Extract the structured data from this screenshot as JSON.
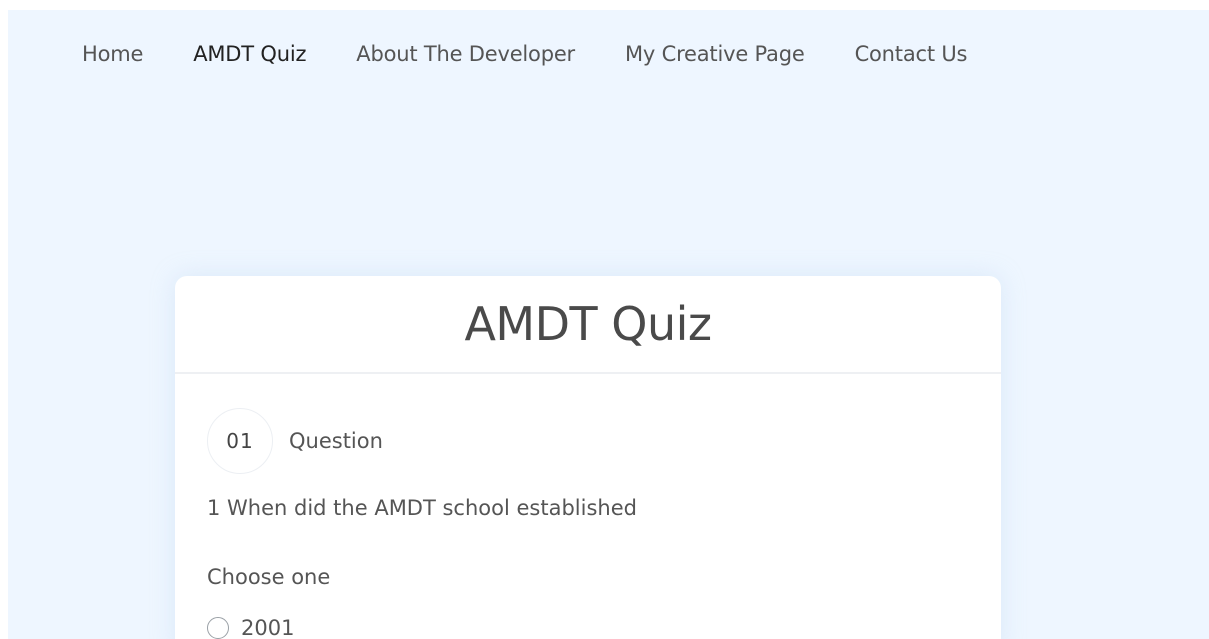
{
  "nav": {
    "items": [
      {
        "label": "Home"
      },
      {
        "label": "AMDT Quiz"
      },
      {
        "label": "About The Developer"
      },
      {
        "label": "My Creative Page"
      },
      {
        "label": "Contact Us"
      }
    ],
    "active_index": 1
  },
  "quiz": {
    "title": "AMDT Quiz",
    "question_number": "01",
    "question_label": "Question",
    "question_text": "1 When did the AMDT school established",
    "choose_label": "Choose one",
    "options": [
      {
        "label": "2001"
      }
    ]
  },
  "colors": {
    "page_background": "#eef6ff",
    "card_background": "#ffffff",
    "text": "#555555"
  }
}
